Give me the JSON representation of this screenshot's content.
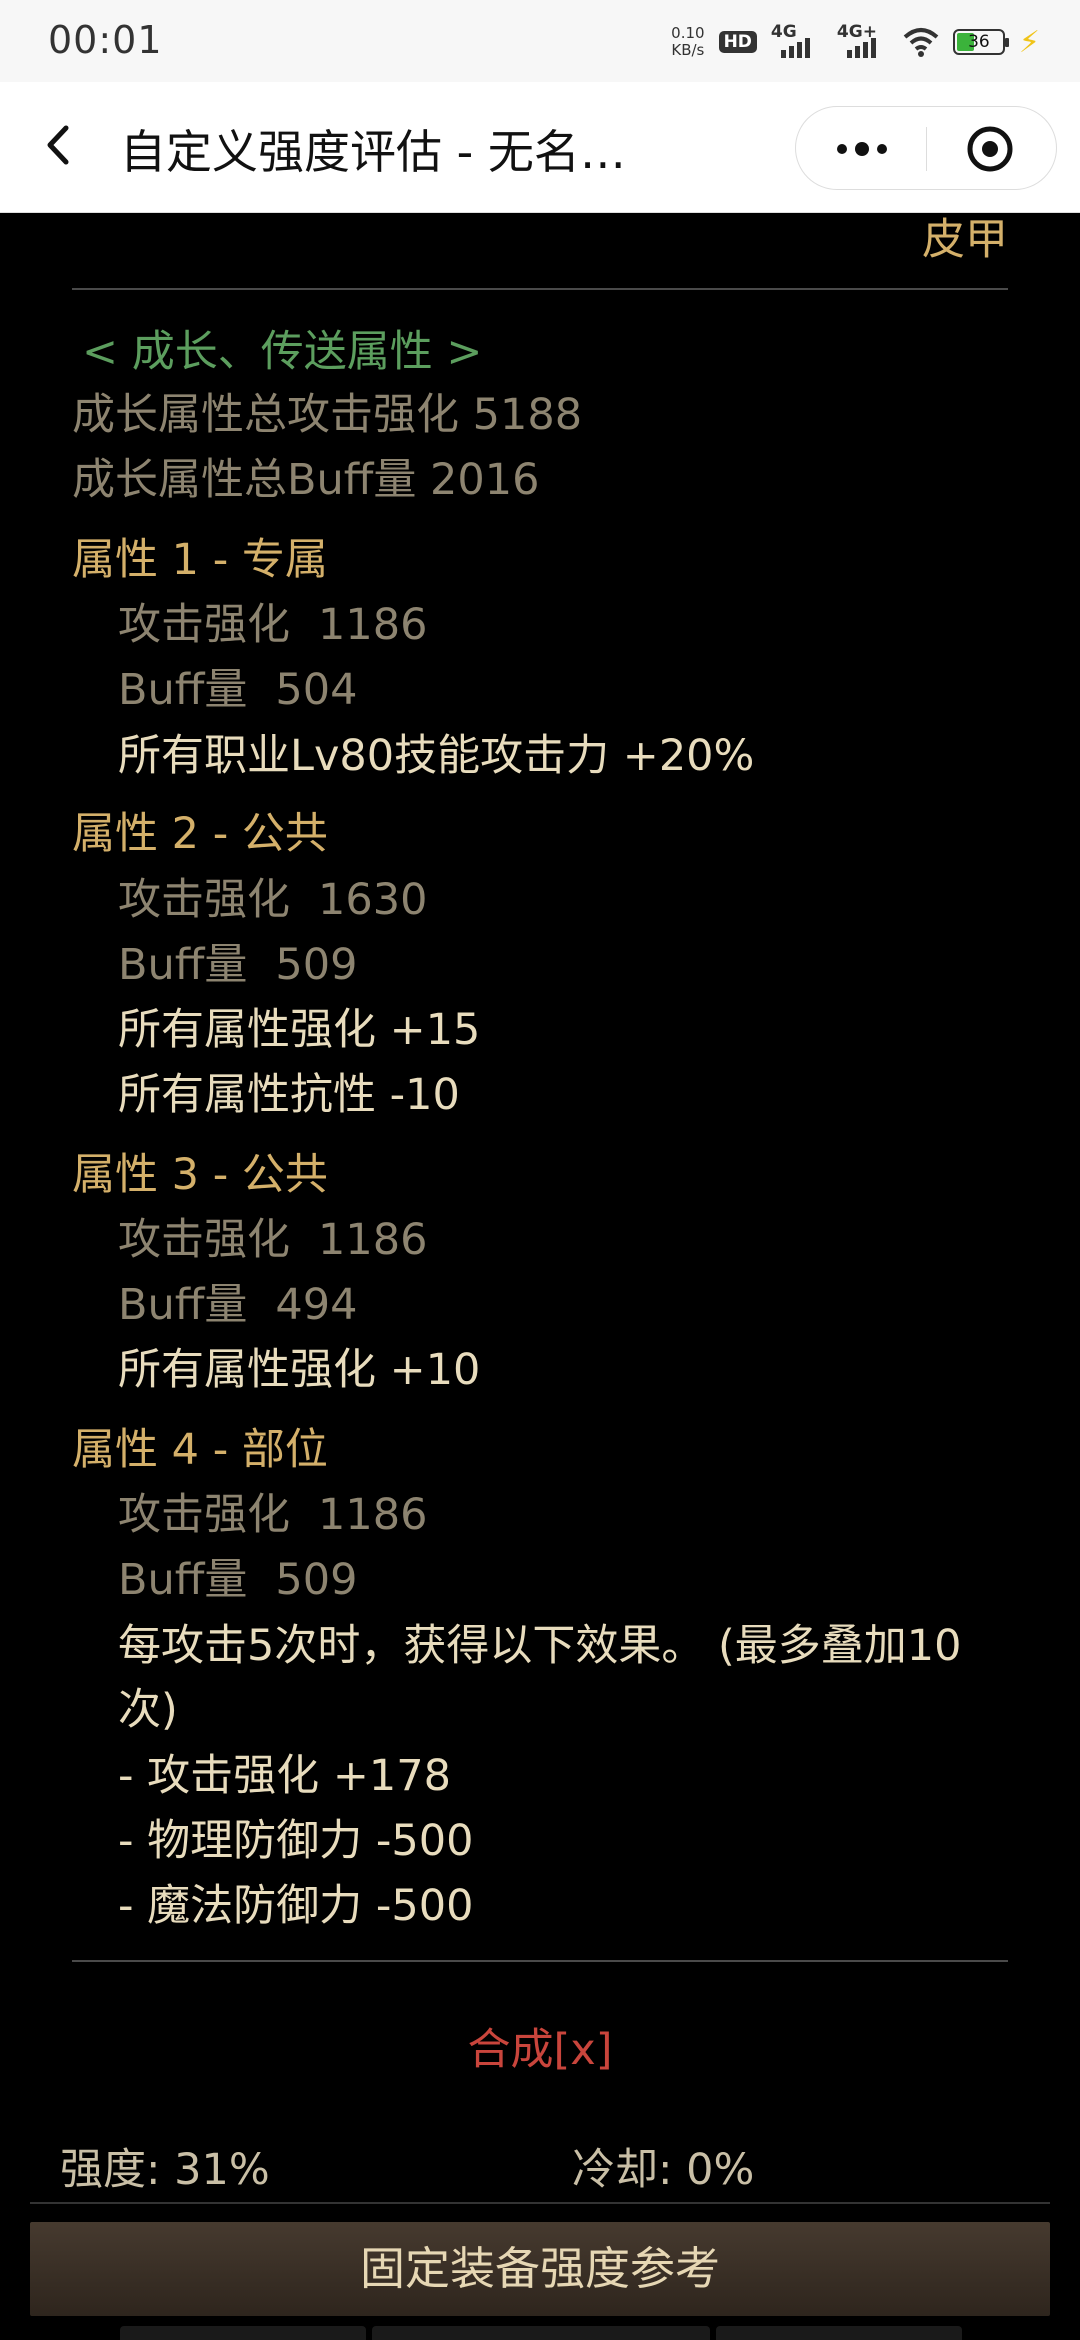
{
  "status_bar": {
    "time": "00:01",
    "speed_value": "0.10",
    "speed_unit": "KB/s",
    "hd_badge": "HD",
    "sim1_label": "4G",
    "sim2_label": "4G+",
    "battery_level": "36"
  },
  "nav": {
    "title": "自定义强度评估 - 无名…"
  },
  "armor_type": "皮甲",
  "growth_section": {
    "header": "< 成长、传送属性 >",
    "total_attack": "成长属性总攻击强化 5188",
    "total_buff": "成长属性总Buff量 2016"
  },
  "attributes": [
    {
      "title": "属性 1 - 专属",
      "attack_label": "攻击强化",
      "attack_value": "1186",
      "buff_label": "Buff量",
      "buff_value": "504",
      "effects": [
        "所有职业Lv80技能攻击力 +20%"
      ]
    },
    {
      "title": "属性 2 - 公共",
      "attack_label": "攻击强化",
      "attack_value": "1630",
      "buff_label": "Buff量",
      "buff_value": "509",
      "effects": [
        "所有属性强化 +15",
        "所有属性抗性 -10"
      ]
    },
    {
      "title": "属性 3 - 公共",
      "attack_label": "攻击强化",
      "attack_value": "1186",
      "buff_label": "Buff量",
      "buff_value": "494",
      "effects": [
        "所有属性强化 +10"
      ]
    },
    {
      "title": "属性 4 - 部位",
      "attack_label": "攻击强化",
      "attack_value": "1186",
      "buff_label": "Buff量",
      "buff_value": "509",
      "effects": [
        "每攻击5次时，获得以下效果。 (最多叠加10",
        "次)",
        "- 攻击强化 +178",
        "- 物理防御力 -500",
        "- 魔法防御力 -500"
      ]
    }
  ],
  "synthesis_link": "合成[x]",
  "strength_label": "强度: 31%",
  "cooldown_label": "冷却: 0%",
  "reference_button": "固定装备强度参考",
  "colors": {
    "background": "#000000",
    "gold": "#d4b06a",
    "muted": "#8d8470",
    "cream": "#e8dcbd",
    "green": "#5c9e5e",
    "red": "#c9453c"
  }
}
